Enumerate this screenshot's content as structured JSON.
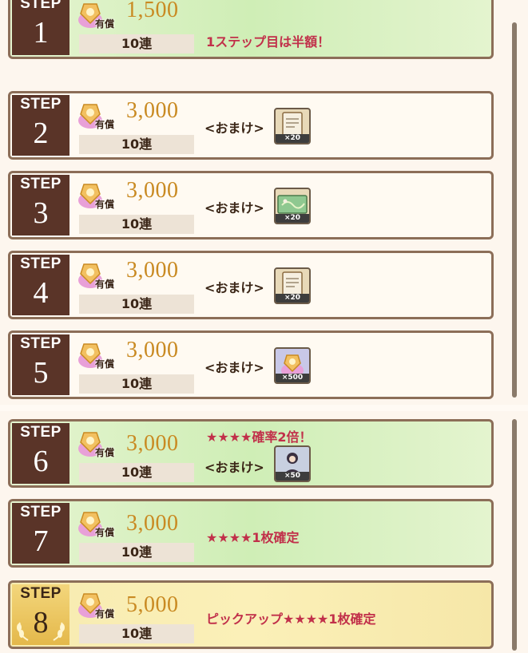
{
  "currency_label": "有償",
  "bonus_label": "<おまけ>",
  "step_label": "STEP",
  "top_steps": [
    {
      "step": "1",
      "price": "1,500",
      "pulls": "10連",
      "note": "1ステップ目は半額！",
      "style": "green"
    },
    {
      "step": "2",
      "price": "3,000",
      "pulls": "10連",
      "item_icon": "document-clipboard-icon",
      "item_count": "×20",
      "style": "plain"
    },
    {
      "step": "3",
      "price": "3,000",
      "pulls": "10連",
      "item_icon": "map-ticket-icon",
      "item_count": "×20",
      "style": "plain"
    },
    {
      "step": "4",
      "price": "3,000",
      "pulls": "10連",
      "item_icon": "document-clipboard-icon",
      "item_count": "×20",
      "style": "plain"
    },
    {
      "step": "5",
      "price": "3,000",
      "pulls": "10連",
      "item_icon": "gem-bag-icon",
      "item_count": "×500",
      "style": "plain"
    }
  ],
  "bottom_steps": [
    {
      "step": "6",
      "price": "3,000",
      "pulls": "10連",
      "note": "★★★★確率2倍！",
      "item_icon": "character-portrait-icon",
      "item_count": "×50",
      "style": "green"
    },
    {
      "step": "7",
      "price": "3,000",
      "pulls": "10連",
      "note": "★★★★1枚確定",
      "style": "green"
    },
    {
      "step": "8",
      "price": "5,000",
      "pulls": "10連",
      "note": "ピックアップ★★★★1枚確定",
      "style": "gold"
    }
  ],
  "colors": {
    "price": "#c98a22",
    "note": "#c1304a",
    "step_box": "#5a3428",
    "border": "#8c6e58"
  }
}
